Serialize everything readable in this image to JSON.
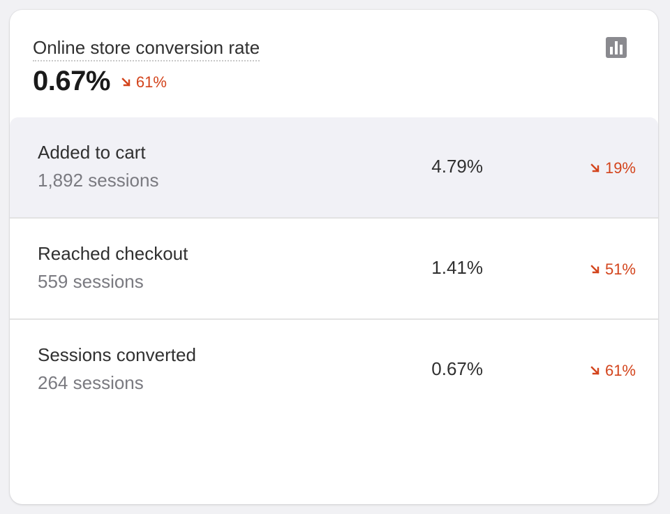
{
  "card": {
    "title": "Online store conversion rate",
    "value": "0.67%",
    "change": "61%",
    "change_direction": "down",
    "chart_icon": "bar-chart-icon"
  },
  "colors": {
    "negative": "#d3441c",
    "text": "#303030",
    "subdued": "#7a7a80",
    "icon": "#8a8a8f"
  },
  "funnel": [
    {
      "label": "Added to cart",
      "sessions": "1,892 sessions",
      "rate": "4.79%",
      "change": "19%"
    },
    {
      "label": "Reached checkout",
      "sessions": "559 sessions",
      "rate": "1.41%",
      "change": "51%"
    },
    {
      "label": "Sessions converted",
      "sessions": "264 sessions",
      "rate": "0.67%",
      "change": "61%"
    }
  ]
}
